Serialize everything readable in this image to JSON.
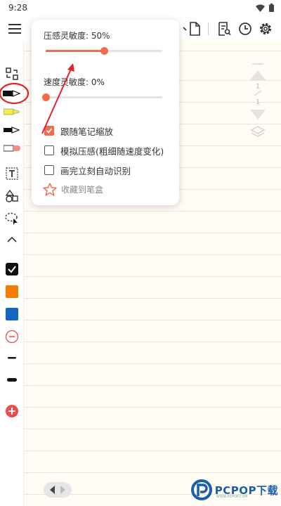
{
  "status_bar": {
    "time": "9:28"
  },
  "popup": {
    "pressure_label": "压感灵敏度: 50%",
    "pressure_value": 0.5,
    "speed_label": "速度灵敏度: 0%",
    "speed_value": 0.0,
    "options": [
      {
        "label": "跟随笔记缩放",
        "checked": true
      },
      {
        "label": "模拟压感(粗细随速度变化)",
        "checked": false
      },
      {
        "label": "画完立刻自动识别",
        "checked": false
      }
    ],
    "favorite_label": "收藏到笔盒"
  },
  "pager": {
    "current": "1",
    "total": "1"
  },
  "watermark": {
    "text": "PCPOP下载",
    "subtext": "WWW.PCPOP.COM"
  },
  "colors": {
    "accent": "#f26b4c",
    "annotation_red": "#e8202a",
    "swatch_black": "#111111",
    "swatch_orange": "#f57c00",
    "swatch_blue": "#1565c0",
    "add_red": "#ee4b4b"
  },
  "icons": {
    "toolbar": [
      "menu-icon",
      "page-icon",
      "document-icon",
      "search-document-icon",
      "clock-icon",
      "settings-icon"
    ],
    "left": [
      "convert-icon",
      "pen-icon",
      "highlighter-icon",
      "ballpen-icon",
      "eraser-icon",
      "text-box-icon",
      "shapes-icon",
      "lasso-icon",
      "collapse-icon",
      "black-swatch-icon",
      "orange-swatch-icon",
      "blue-swatch-icon",
      "minus-icon",
      "thin-line-icon",
      "thick-line-icon",
      "add-icon"
    ]
  }
}
